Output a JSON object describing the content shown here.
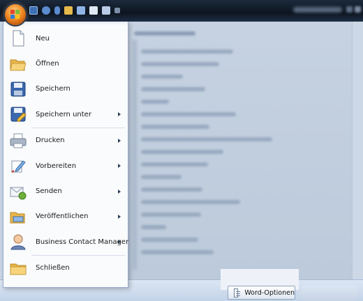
{
  "menu": {
    "items": [
      {
        "label": "Neu",
        "icon": "new-document-icon",
        "submenu": false
      },
      {
        "label": "Öffnen",
        "icon": "open-folder-icon",
        "submenu": false
      },
      {
        "label": "Speichern",
        "icon": "save-icon",
        "submenu": false
      },
      {
        "label": "Speichern unter",
        "icon": "save-as-icon",
        "submenu": true
      },
      {
        "label": "Drucken",
        "icon": "printer-icon",
        "submenu": true
      },
      {
        "label": "Vorbereiten",
        "icon": "prepare-pen-icon",
        "submenu": true
      },
      {
        "label": "Senden",
        "icon": "send-mail-icon",
        "submenu": true
      },
      {
        "label": "Veröffentlichen",
        "icon": "publish-folder-icon",
        "submenu": true
      },
      {
        "label": "Business Contact Manager",
        "icon": "contact-person-icon",
        "submenu": true
      },
      {
        "label": "Schließen",
        "icon": "close-folder-icon",
        "submenu": false
      }
    ]
  },
  "footer": {
    "options_label": "Word-Optionen"
  },
  "colors": {
    "office_button": "#f08a24",
    "titlebar": "#0d1520",
    "menu_bg": "#fafbfd",
    "menu_border": "#9aaccb"
  }
}
